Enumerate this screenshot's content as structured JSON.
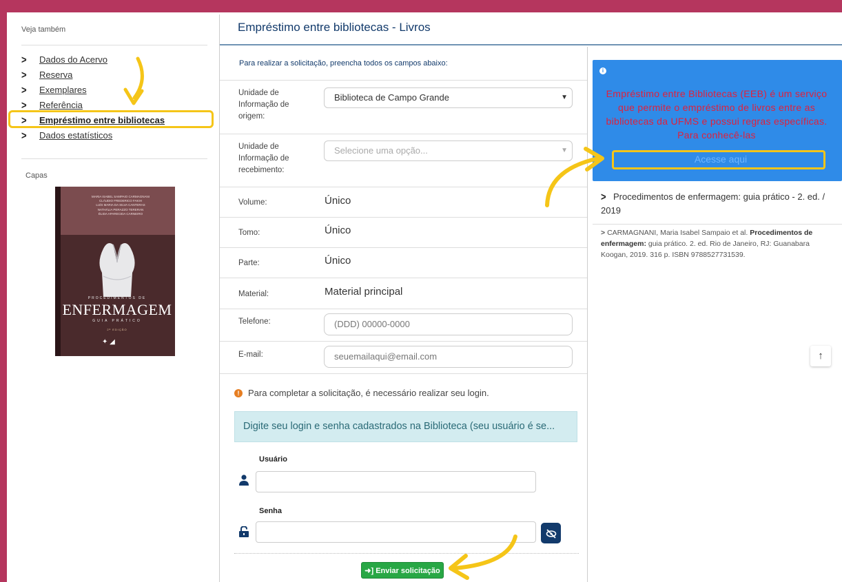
{
  "sidebar": {
    "see_also_title": "Veja também",
    "items": [
      {
        "label": "Dados do Acervo"
      },
      {
        "label": "Reserva"
      },
      {
        "label": "Exemplares"
      },
      {
        "label": "Referência"
      },
      {
        "label": "Empréstimo entre bibliotecas",
        "active": true
      },
      {
        "label": "Dados estatísticos"
      }
    ],
    "covers_title": "Capas",
    "cover": {
      "authors": [
        "MARIA ISABEL SAMPAIO CARMAGNANI",
        "CLÁUDIO FREDERICO FAKIH",
        "LUÍS MARIA DA SILVA CANTERAS",
        "NATHÁLIA PERAZZO TERERAN",
        "ÉLIDA APARECIDA CARNEIRO"
      ],
      "subtitle_top": "PROCEDIMENTOS DE",
      "title": "ENFERMAGEM",
      "subtitle_bottom": "GUIA PRÁTICO",
      "edition": "2ª EDIÇÃO"
    }
  },
  "main": {
    "heading": "Empréstimo entre bibliotecas - Livros",
    "intro": "Para realizar a solicitação, preencha todos os campos abaixo:",
    "fields": {
      "origem_label": "Unidade de Informação de origem:",
      "origem_value": "Biblioteca de Campo Grande",
      "recebimento_label": "Unidade de Informação de recebimento:",
      "recebimento_placeholder": "Selecione uma opção...",
      "volume_label": "Volume:",
      "volume_value": "Único",
      "tomo_label": "Tomo:",
      "tomo_value": "Único",
      "parte_label": "Parte:",
      "parte_value": "Único",
      "material_label": "Material:",
      "material_value": "Material principal",
      "telefone_label": "Telefone:",
      "telefone_placeholder": "(DDD) 00000-0000",
      "email_label": "E-mail:",
      "email_placeholder": "seuemailaqui@email.com"
    },
    "login_notice": "Para completar a solicitação, é necessário realizar seu login.",
    "login_alert": "Digite seu login e senha cadastrados na Biblioteca (seu usuário é se...",
    "user_label": "Usuário",
    "password_label": "Senha",
    "submit_label": "Enviar solicitação"
  },
  "right": {
    "eeb_text": "Empréstimo entre Bibliotecas (EEB) é um serviço que permite o empréstimo de livros entre as bibliotecas da UFMS e possui regras específicas. Para conhecê-las",
    "eeb_link": "Acesse aqui",
    "ref_title": "Procedimentos de enfermagem: guia prático - 2. ed. / 2019",
    "ref_cite_author": "CARMAGNANI, Maria Isabel Sampaio et al.",
    "ref_cite_title": "Procedimentos de enfermagem:",
    "ref_cite_rest": "guia prático. 2. ed. Rio de Janeiro, RJ: Guanabara Koogan, 2019. 316 p. ISBN 9788527731539."
  },
  "colors": {
    "frame": "#b5365e",
    "highlight": "#f5c518",
    "primary": "#123a6b",
    "eeb_panel": "#2f8be8",
    "eeb_text": "#e0203c",
    "submit": "#28a745"
  }
}
